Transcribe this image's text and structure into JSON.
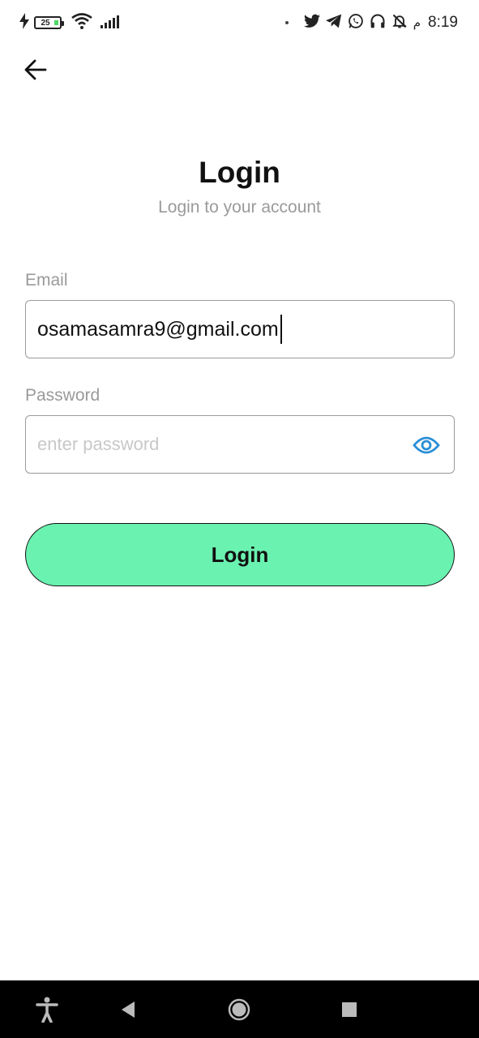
{
  "status_bar": {
    "battery_level": "25",
    "time": "8:19",
    "am_pm": "م",
    "icons": [
      "charging-icon",
      "battery-icon",
      "wifi-icon",
      "signal-icon",
      "twitter-icon",
      "telegram-icon",
      "whatsapp-icon",
      "headphones-icon",
      "bell-muted-icon"
    ]
  },
  "header": {
    "title": "Login",
    "subtitle": "Login to your account"
  },
  "form": {
    "email_label": "Email",
    "email_value": "osamasamra9@gmail.com",
    "password_label": "Password",
    "password_placeholder": "enter password",
    "submit_label": "Login"
  },
  "colors": {
    "accent": "#6af2b0",
    "eye_icon": "#2a8fd6",
    "muted_text": "#9a9a9a"
  }
}
